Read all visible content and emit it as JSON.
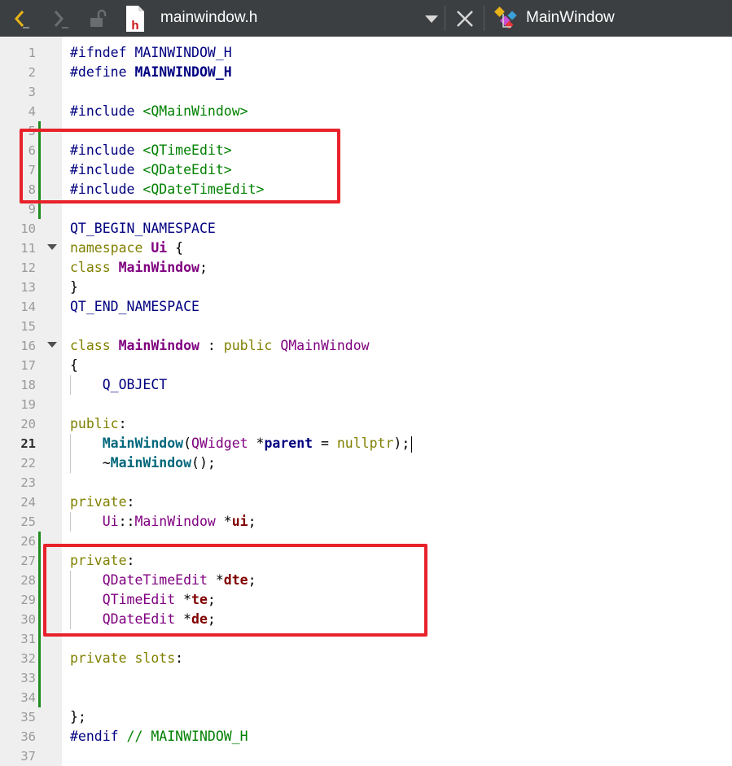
{
  "toolbar": {
    "back_icon": "chevron-left-icon",
    "forward_icon": "chevron-right-icon",
    "lock_icon": "unlocked-icon",
    "file_icon": "header-file-icon",
    "file_name": "mainwindow.h",
    "dropdown_icon": "triangle-down-icon",
    "close_icon": "close-icon",
    "class_icon": "class-symbol-icon",
    "class_name": "MainWindow"
  },
  "gutter": {
    "line_numbers": [
      "1",
      "2",
      "3",
      "4",
      "5",
      "6",
      "7",
      "8",
      "9",
      "10",
      "11",
      "12",
      "13",
      "14",
      "15",
      "16",
      "17",
      "18",
      "19",
      "20",
      "21",
      "22",
      "23",
      "24",
      "25",
      "26",
      "27",
      "28",
      "29",
      "30",
      "31",
      "32",
      "33",
      "34",
      "35",
      "36",
      "37"
    ],
    "current_line": "21"
  },
  "code": {
    "l1": [
      "#ifndef",
      " ",
      "MAINWINDOW_H"
    ],
    "l2": [
      "#define",
      " ",
      "MAINWINDOW_H"
    ],
    "l4": [
      "#include",
      " ",
      "<QMainWindow>"
    ],
    "l6": [
      "#include",
      " ",
      "<QTimeEdit>"
    ],
    "l7": [
      "#include",
      " ",
      "<QDateEdit>"
    ],
    "l8": [
      "#include",
      " ",
      "<QDateTimeEdit>"
    ],
    "l10": [
      "QT_BEGIN_NAMESPACE"
    ],
    "l11": [
      "namespace",
      " ",
      "Ui",
      " {"
    ],
    "l12": [
      "class",
      " ",
      "MainWindow",
      ";"
    ],
    "l13": [
      "}"
    ],
    "l14": [
      "QT_END_NAMESPACE"
    ],
    "l16": [
      "class",
      " ",
      "MainWindow",
      " : ",
      "public",
      " ",
      "QMainWindow"
    ],
    "l17": [
      "{"
    ],
    "l18": [
      "    ",
      "Q_OBJECT"
    ],
    "l20": [
      "public",
      ":"
    ],
    "l21": [
      "    ",
      "MainWindow",
      "(",
      "QWidget",
      " *",
      "parent",
      " = ",
      "nullptr",
      ");"
    ],
    "l22": [
      "    ~",
      "MainWindow",
      "();"
    ],
    "l24": [
      "private",
      ":"
    ],
    "l25": [
      "    ",
      "Ui",
      "::",
      "MainWindow",
      " *",
      "ui",
      ";"
    ],
    "l27": [
      "private",
      ":"
    ],
    "l28": [
      "    ",
      "QDateTimeEdit",
      " *",
      "dte",
      ";"
    ],
    "l29": [
      "    ",
      "QTimeEdit",
      " *",
      "te",
      ";"
    ],
    "l30": [
      "    ",
      "QDateEdit",
      " *",
      "de",
      ";"
    ],
    "l32": [
      "private",
      " ",
      "slots",
      ":"
    ],
    "l35": [
      "};"
    ],
    "l36": [
      "#endif",
      " ",
      "// MAINWINDOW_H"
    ]
  },
  "colors": {
    "toolbar_bg": "#3c3f41",
    "gutter_bg": "#efefef",
    "change_marker": "#1e8c1e",
    "highlight_box": "#e8222b",
    "preprocessor": "#000080",
    "keyword": "#808000",
    "include_string": "#008000",
    "class_name": "#800080",
    "function_name": "#00677c",
    "member": "#800000"
  }
}
